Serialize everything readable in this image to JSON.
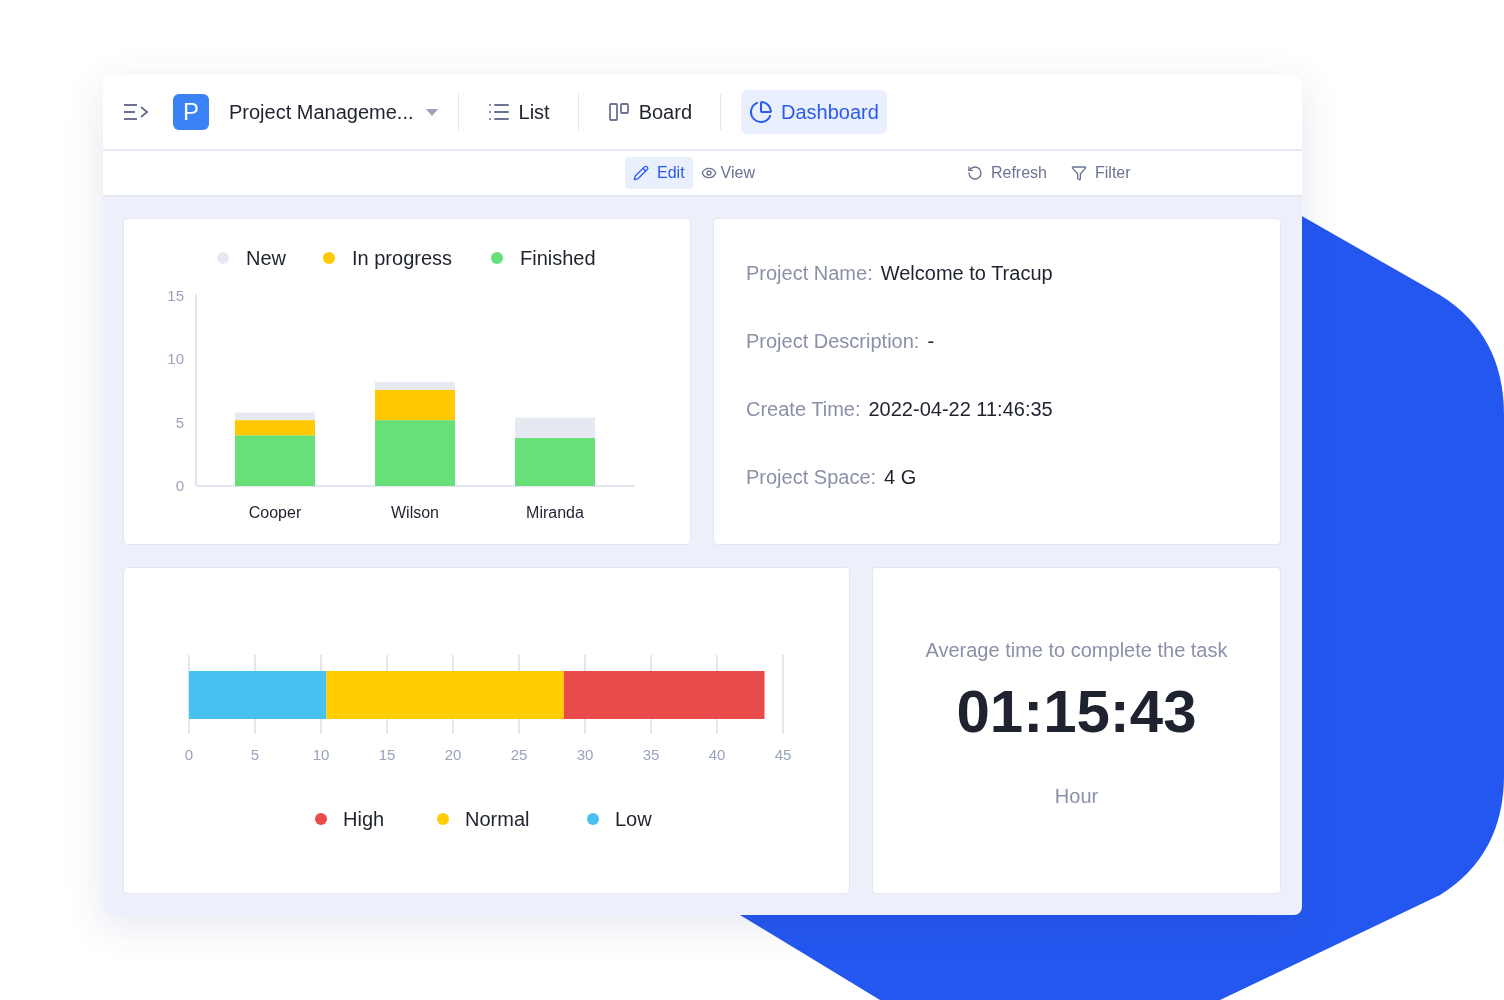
{
  "header": {
    "project": {
      "logo": "P",
      "name": "Project Manageme..."
    },
    "tabs": [
      {
        "kind": "list",
        "label": "List",
        "selected": false
      },
      {
        "kind": "board",
        "label": "Board",
        "selected": false
      },
      {
        "kind": "dashboard",
        "label": "Dashboard",
        "selected": true
      }
    ]
  },
  "toolbar": {
    "modes": [
      {
        "kind": "edit",
        "label": "Edit",
        "selected": true
      },
      {
        "kind": "view",
        "label": "View",
        "selected": false
      }
    ],
    "actions": [
      {
        "kind": "refresh",
        "label": "Refresh"
      },
      {
        "kind": "filter",
        "label": "Filter"
      }
    ]
  },
  "status_chart": {
    "chart_data": {
      "type": "bar",
      "stacked": true,
      "categories": [
        "Cooper",
        "Wilson",
        "Miranda"
      ],
      "ylim": [
        0,
        15
      ],
      "legend": "top",
      "yticks": [
        0,
        5,
        10,
        15
      ],
      "series": [
        {
          "name": "New",
          "color": "#e6e9f2",
          "values": [
            0.6,
            0.6,
            1.6
          ]
        },
        {
          "name": "In progress",
          "color": "#ffc800",
          "values": [
            1.2,
            2.4,
            0
          ]
        },
        {
          "name": "Finished",
          "color": "#68e07a",
          "values": [
            4,
            5.2,
            3.8
          ]
        }
      ]
    }
  },
  "project_info": [
    {
      "label": "Project Name:",
      "value": "Welcome to Tracup"
    },
    {
      "label": "Project Description:",
      "value": "-"
    },
    {
      "label": "Create Time:",
      "value": "2022-04-22 11:46:35"
    },
    {
      "label": "Project Space:",
      "value": "4 G"
    }
  ],
  "priority_chart": {
    "chart_data": {
      "type": "bar",
      "orientation": "horizontal",
      "stacked": true,
      "xlim": [
        0,
        45
      ],
      "legend": "bottom",
      "grid": true,
      "xticks": [
        0,
        5,
        10,
        15,
        20,
        25,
        30,
        35,
        40,
        45
      ],
      "series": [
        {
          "name": "High",
          "color": "#e94a4a",
          "values": [
            15.2
          ]
        },
        {
          "name": "Normal",
          "color": "#ffcd00",
          "values": [
            18
          ]
        },
        {
          "name": "Low",
          "color": "#48c1f0",
          "values": [
            10.4
          ]
        }
      ]
    }
  },
  "average_time": {
    "title": "Average time to complete the task",
    "value": "01:15:43",
    "unit": "Hour"
  }
}
